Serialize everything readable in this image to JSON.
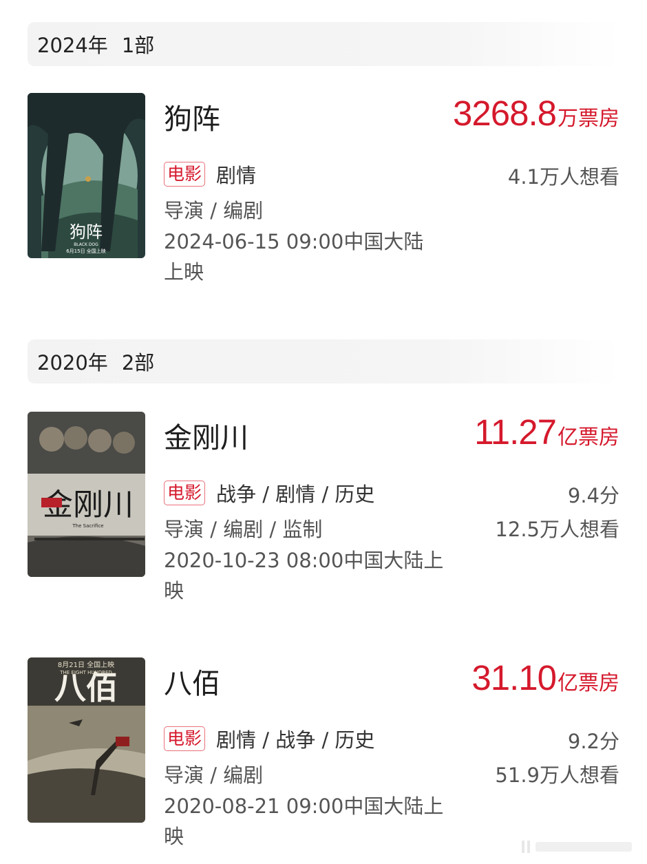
{
  "sections": [
    {
      "year": "2024年",
      "count": "1部"
    },
    {
      "year": "2020年",
      "count": "2部"
    }
  ],
  "movies": [
    {
      "title": "狗阵",
      "box_num": "3268.8",
      "box_unit": "万票房",
      "tag": "电影",
      "genres": "剧情",
      "roles": "导演 / 编剧",
      "release_1": "2024-06-15 09:00中国大陆",
      "release_2": "上映",
      "score": "",
      "wants": "4.1万人想看",
      "poster_text": "狗阵",
      "poster_sub": "BLACK DOG",
      "poster_date": "6月15日 全国上映"
    },
    {
      "title": "金刚川",
      "box_num": "11.27",
      "box_unit": "亿票房",
      "tag": "电影",
      "genres": "战争 / 剧情 / 历史",
      "roles": "导演 / 编剧 / 监制",
      "release_1": "2020-10-23 08:00中国大陆上",
      "release_2": "映",
      "score": "9.4分",
      "wants": "12.5万人想看",
      "poster_text": "金刚川",
      "poster_sub": "The Sacrifice"
    },
    {
      "title": "八佰",
      "box_num": "31.10",
      "box_unit": "亿票房",
      "tag": "电影",
      "genres": "剧情 / 战争 / 历史",
      "roles": "导演 / 编剧",
      "release_1": "2020-08-21 09:00中国大陆上",
      "release_2": "映",
      "score": "9.2分",
      "wants": "51.9万人想看",
      "poster_text": "八佰",
      "poster_sub": "THE EIGHT HUNDRED",
      "poster_date": "8月21日 全国上映"
    }
  ],
  "colors": {
    "accent": "#d5192c",
    "tag_border": "#e8707a",
    "section_bg": "#f3f3f3"
  }
}
